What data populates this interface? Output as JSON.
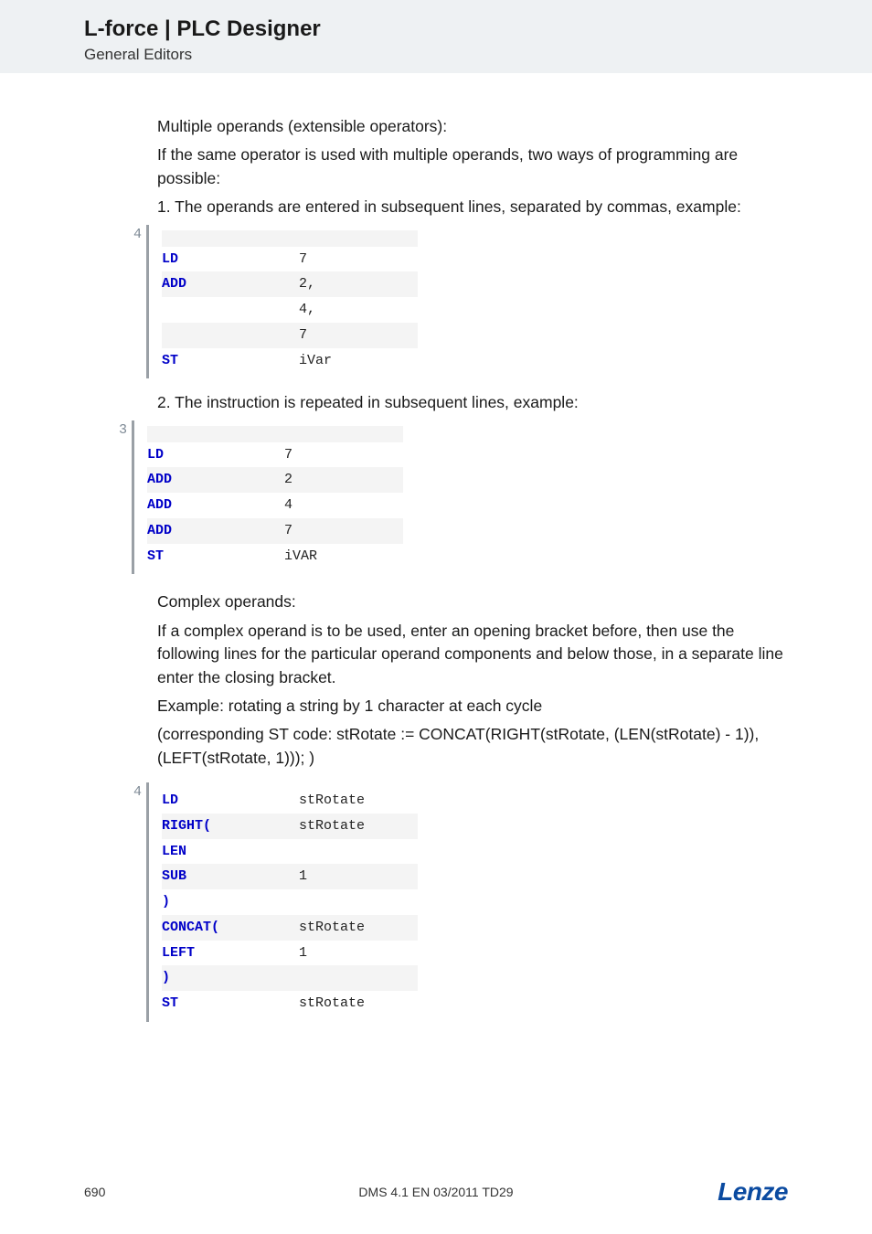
{
  "header": {
    "title": "L-force | PLC Designer",
    "subtitle": "General Editors"
  },
  "body": {
    "p1": "Multiple operands (extensible operators):",
    "p2": "If the same operator is used with multiple operands, two ways of programming are possible:",
    "p3": "1. The operands are entered in subsequent lines, separated by commas, example:",
    "code1_gutter": "4",
    "code1": [
      {
        "op": "LD",
        "arg": "7"
      },
      {
        "op": "ADD",
        "arg": "2,"
      },
      {
        "op": "",
        "arg": "4,"
      },
      {
        "op": "",
        "arg": "7"
      },
      {
        "op": "ST",
        "arg": "iVar"
      }
    ],
    "p4": "2. The instruction is repeated in subsequent lines, example:",
    "code2_gutter": "3",
    "code2": [
      {
        "op": "LD",
        "arg": "7"
      },
      {
        "op": "ADD",
        "arg": "2"
      },
      {
        "op": "ADD",
        "arg": "4"
      },
      {
        "op": "ADD",
        "arg": "7"
      },
      {
        "op": "ST",
        "arg": "iVAR"
      }
    ],
    "p5": "Complex operands:",
    "p6": "If a complex operand is to be used, enter an opening bracket before, then use the following lines for the particular operand components and below those, in a separate line enter the closing bracket.",
    "p7": "Example: rotating a string by 1 character at each cycle",
    "p8": "(corresponding ST code: stRotate := CONCAT(RIGHT(stRotate, (LEN(stRotate) - 1)), (LEFT(stRotate, 1))); )",
    "code3_gutter": "4",
    "code3": [
      {
        "op": "LD",
        "arg": "stRotate"
      },
      {
        "op": "RIGHT(",
        "arg": "stRotate"
      },
      {
        "op": "LEN",
        "arg": ""
      },
      {
        "op": "SUB",
        "arg": "1"
      },
      {
        "op": ")",
        "arg": ""
      },
      {
        "op": "CONCAT(",
        "arg": "stRotate"
      },
      {
        "op": "LEFT",
        "arg": "1"
      },
      {
        "op": ")",
        "arg": ""
      },
      {
        "op": "ST",
        "arg": "stRotate"
      }
    ]
  },
  "footer": {
    "page": "690",
    "docid": "DMS 4.1 EN 03/2011 TD29",
    "logo": "Lenze"
  }
}
